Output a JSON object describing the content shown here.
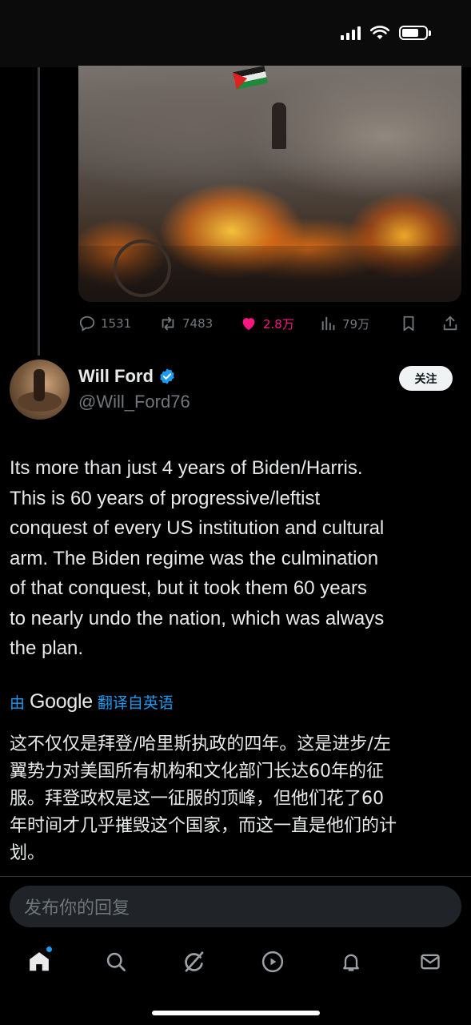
{
  "status_bar": {
    "signal": "signal-icon",
    "wifi": "wifi-icon",
    "battery": "battery-icon"
  },
  "tweet_actions": {
    "replies": "1531",
    "reposts": "7483",
    "likes": "2.8万",
    "views": "79万"
  },
  "author": {
    "name": "Will Ford",
    "handle": "@Will_Ford76",
    "verified": true,
    "follow_label": "关注"
  },
  "tweet": {
    "lines": [
      "Its more than just 4 years of Biden/Harris.",
      "This is 60 years of progressive/leftist",
      "conquest of every US institution and cultural",
      "arm. The Biden regime was the culmination",
      "of that conquest, but it took them 60 years",
      "to nearly undo the nation, which was always",
      "the plan."
    ]
  },
  "translation": {
    "prefix": "由",
    "provider": "Google",
    "suffix": "翻译自英语",
    "lines": [
      "这不仅仅是拜登/哈里斯执政的四年。这是进步/左",
      "翼势力对美国所有机构和文化部门长达60年的征",
      "服。拜登政权是这一征服的顶峰，但他们花了60",
      "年时间才几乎摧毁这个国家，而这一直是他们的计",
      "划。"
    ]
  },
  "reply": {
    "placeholder": "发布你的回复"
  },
  "nav": {
    "items": [
      "home-icon",
      "search-icon",
      "grok-icon",
      "video-icon",
      "notifications-icon",
      "messages-icon"
    ],
    "active": "home-icon"
  },
  "colors": {
    "accent": "#1d9bf0",
    "like": "#f91880",
    "muted": "#71767b",
    "background": "#000000"
  }
}
